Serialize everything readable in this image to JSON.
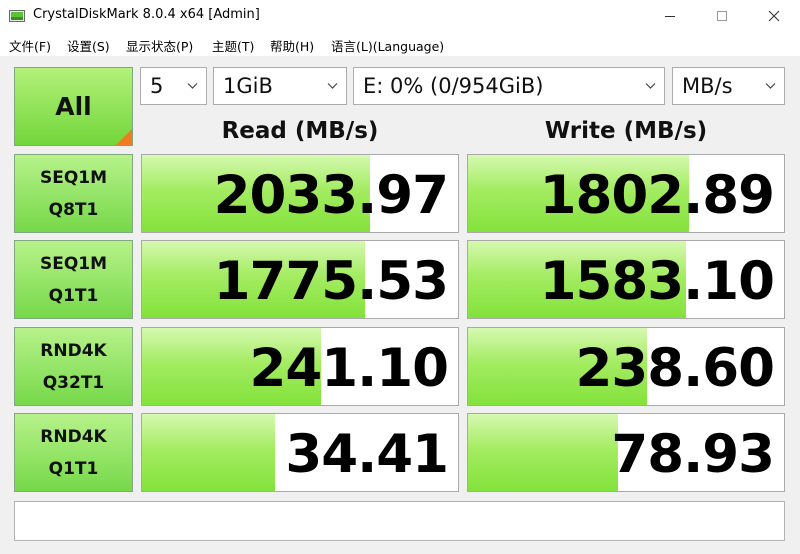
{
  "window": {
    "title": "CrystalDiskMark 8.0.4 x64 [Admin]",
    "controls": [
      "minimize-icon",
      "maximize-icon",
      "close-icon"
    ]
  },
  "menu": [
    "文件(F)",
    "设置(S)",
    "显示状态(P)",
    "主题(T)",
    "帮助(H)",
    "语言(L)(Language)"
  ],
  "all_button": {
    "label": "All"
  },
  "selectors": {
    "count": "5",
    "size": "1GiB",
    "drive": "E: 0% (0/954GiB)",
    "unit": "MB/s"
  },
  "headers": {
    "read": "Read (MB/s)",
    "write": "Write (MB/s)"
  },
  "tests": [
    {
      "line1": "SEQ1M",
      "line2": "Q8T1",
      "read": "2033.97",
      "write": "1802.89",
      "read_fill": 0.72,
      "write_fill": 0.7
    },
    {
      "line1": "SEQ1M",
      "line2": "Q1T1",
      "read": "1775.53",
      "write": "1583.10",
      "read_fill": 0.705,
      "write_fill": 0.69
    },
    {
      "line1": "RND4K",
      "line2": "Q32T1",
      "read": "241.10",
      "write": "238.60",
      "read_fill": 0.565,
      "write_fill": 0.565
    },
    {
      "line1": "RND4K",
      "line2": "Q1T1",
      "read": "34.41",
      "write": "78.93",
      "read_fill": 0.42,
      "write_fill": 0.475
    }
  ],
  "comment": ""
}
